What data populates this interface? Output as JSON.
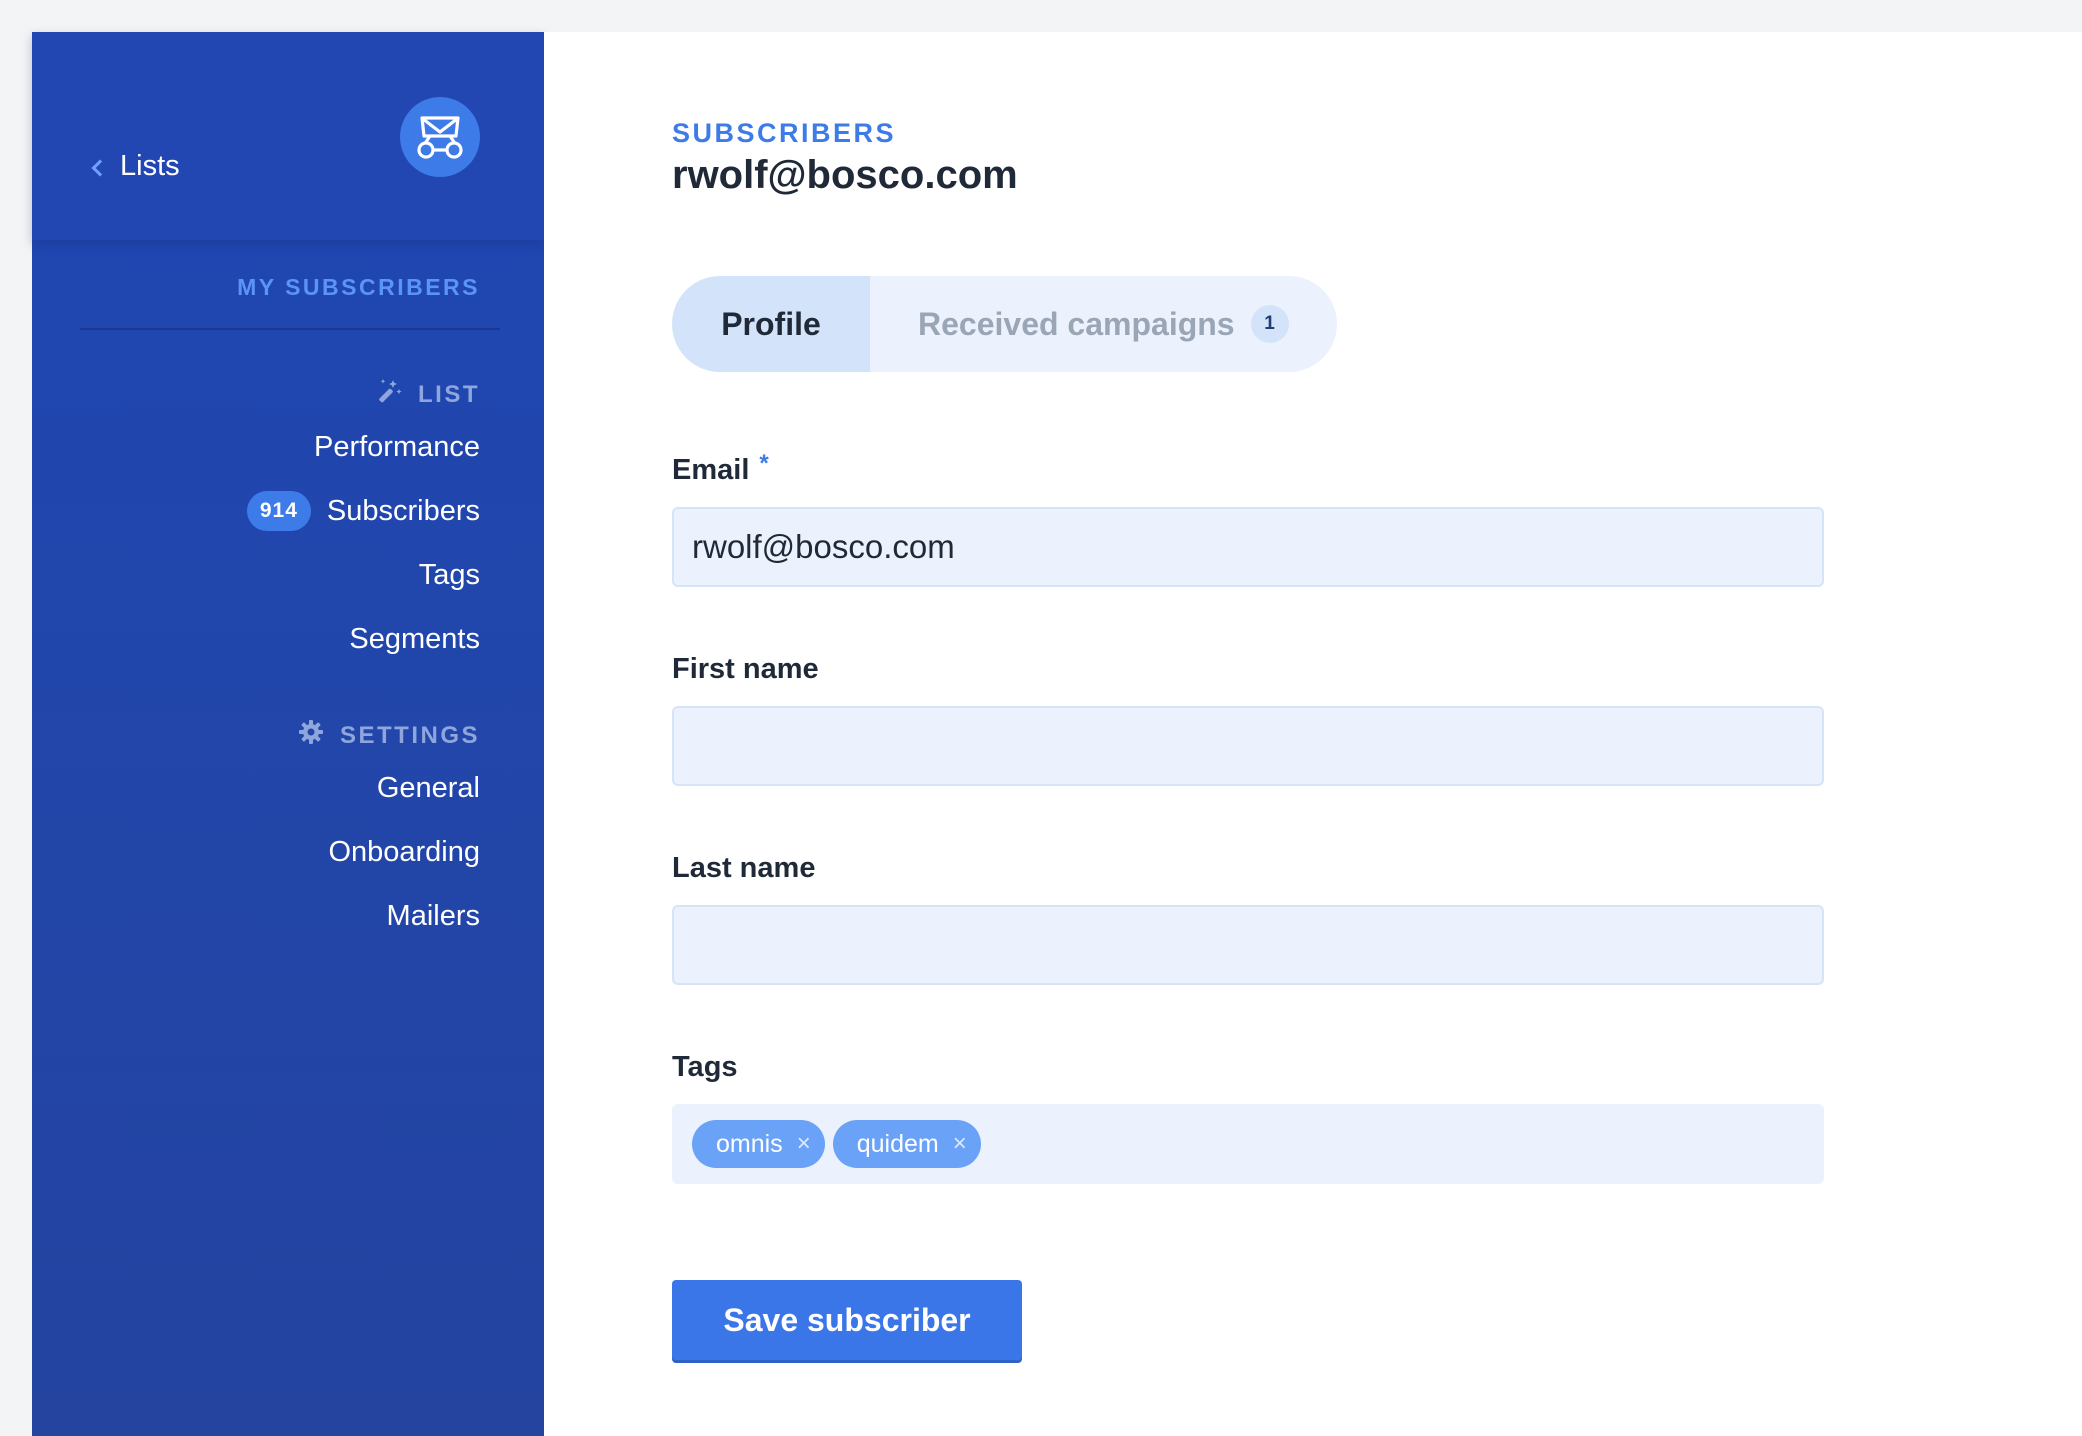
{
  "sidebar": {
    "back_link": "Lists",
    "heading": "MY SUBSCRIBERS",
    "sections": {
      "list": {
        "title": "LIST",
        "items": [
          "Performance",
          "Subscribers",
          "Tags",
          "Segments"
        ],
        "subscribers_count": "914"
      },
      "settings": {
        "title": "SETTINGS",
        "items": [
          "General",
          "Onboarding",
          "Mailers"
        ]
      }
    }
  },
  "header": {
    "eyebrow": "SUBSCRIBERS",
    "title": "rwolf@bosco.com"
  },
  "tabs": {
    "profile": "Profile",
    "received": "Received campaigns",
    "received_count": "1"
  },
  "form": {
    "email": {
      "label": "Email",
      "required_mark": "*",
      "value": "rwolf@bosco.com"
    },
    "first_name": {
      "label": "First name",
      "value": ""
    },
    "last_name": {
      "label": "Last name",
      "value": ""
    },
    "tags": {
      "label": "Tags",
      "values": [
        "omnis",
        "quidem"
      ],
      "remove_glyph": "×"
    },
    "save_label": "Save subscriber"
  },
  "icons": {
    "back": "chevron-left-icon",
    "logo": "mailcoach-logo-icon",
    "list": "magic-wand-icon",
    "settings": "gear-icon"
  },
  "colors": {
    "sidebar": "#2247b3",
    "accent": "#3d7be8",
    "input_bg": "#ebf2fd"
  }
}
